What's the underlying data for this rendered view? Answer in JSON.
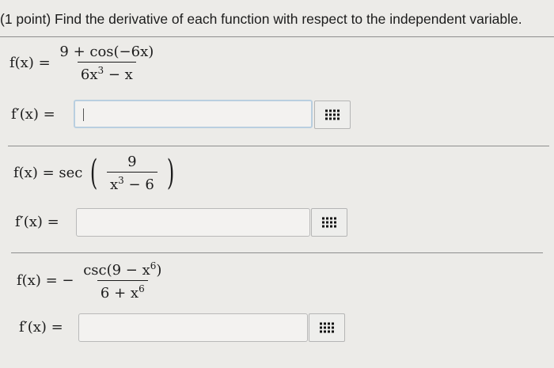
{
  "header": {
    "text": "(1 point) Find the derivative of each function with respect to the independent variable."
  },
  "problems": [
    {
      "lhs": "f(x) =",
      "numerator": "9 + cos(−6x)",
      "denominator_base": "6x",
      "denominator_exp": "3",
      "denominator_rest": " − x",
      "answer_label": "f′(x) =",
      "answer_value": ""
    },
    {
      "lhs": "f(x) = sec",
      "numerator": "9",
      "denominator_base": "x",
      "denominator_exp": "3",
      "denominator_rest": " − 6",
      "answer_label": "f′(x) =",
      "answer_value": ""
    },
    {
      "lhs": "f(x) = −",
      "numerator_pre": "csc(9 − x",
      "numerator_exp": "6",
      "numerator_post": ")",
      "denominator_pre": "6 + x",
      "denominator_exp": "6",
      "answer_label": "f′(x) =",
      "answer_value": ""
    }
  ],
  "icons": {
    "keypad": "keypad-grid-icon"
  },
  "colors": {
    "background": "#ecebe8",
    "input_focus_border": "#b9cfe0"
  }
}
